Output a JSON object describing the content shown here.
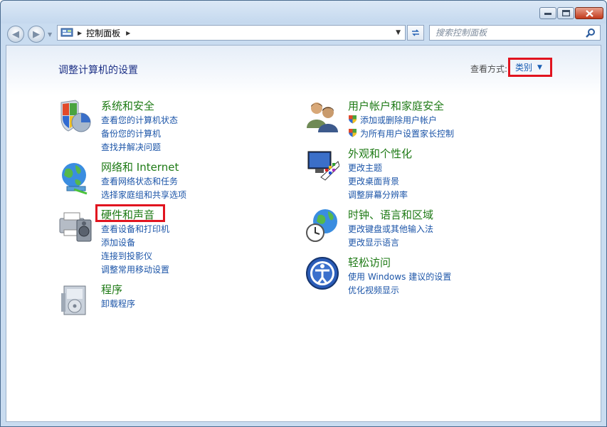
{
  "breadcrumb": {
    "root": "控制面板"
  },
  "search": {
    "placeholder": "搜索控制面板"
  },
  "page": {
    "title": "调整计算机的设置"
  },
  "view_by": {
    "label": "查看方式:",
    "value": "类别"
  },
  "categories": [
    {
      "title": "系统和安全",
      "links": [
        "查看您的计算机状态",
        "备份您的计算机",
        "查找并解决问题"
      ]
    },
    {
      "title": "网络和 Internet",
      "links": [
        "查看网络状态和任务",
        "选择家庭组和共享选项"
      ]
    },
    {
      "title": "硬件和声音",
      "links": [
        "查看设备和打印机",
        "添加设备",
        "连接到投影仪",
        "调整常用移动设置"
      ]
    },
    {
      "title": "程序",
      "links": [
        "卸载程序"
      ]
    },
    {
      "title": "用户帐户和家庭安全",
      "links": [
        "添加或删除用户帐户",
        "为所有用户设置家长控制"
      ]
    },
    {
      "title": "外观和个性化",
      "links": [
        "更改主题",
        "更改桌面背景",
        "调整屏幕分辨率"
      ]
    },
    {
      "title": "时钟、语言和区域",
      "links": [
        "更改键盘或其他输入法",
        "更改显示语言"
      ]
    },
    {
      "title": "轻松访问",
      "links": [
        "使用 Windows 建议的设置",
        "优化视频显示"
      ]
    }
  ],
  "icons": {
    "system_security": "shield-pie-icon",
    "network": "globe-network-icon",
    "hardware": "printer-speaker-icon",
    "programs": "program-box-icon",
    "user_accounts": "users-icon",
    "appearance": "monitor-palette-icon",
    "clock": "clock-globe-icon",
    "ease_access": "ease-of-access-icon"
  },
  "colors": {
    "category_title": "#1e7a15",
    "link": "#1c55a8",
    "highlight": "#e1141f"
  }
}
